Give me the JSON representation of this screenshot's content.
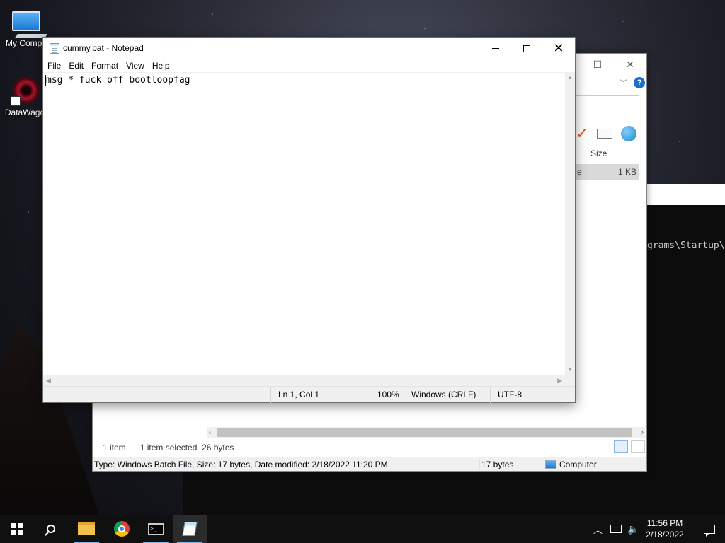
{
  "desktop": {
    "icons": [
      {
        "label": "My Compu",
        "icon": "computer-icon"
      },
      {
        "label": "DataWagor",
        "icon": "data-wagon-icon"
      }
    ]
  },
  "console": {
    "text": "grams\\Startup\\"
  },
  "explorer": {
    "column_size": "Size",
    "row_size": "1 KB",
    "row_partial": "e",
    "item_count": "1 item",
    "selection": "1 item selected  26 bytes",
    "status_details": "Type: Windows Batch File, Size: 17 bytes, Date modified: 2/18/2022 11:20 PM",
    "status_size": "17 bytes",
    "status_location": "Computer",
    "help_label": "?"
  },
  "notepad": {
    "title": "cummy.bat - Notepad",
    "menu": [
      "File",
      "Edit",
      "Format",
      "View",
      "Help"
    ],
    "content": "msg * fuck off bootloopfag",
    "status": {
      "position": "Ln 1, Col 1",
      "zoom": "100%",
      "line_ending": "Windows (CRLF)",
      "encoding": "UTF-8"
    }
  },
  "taskbar": {
    "apps": [
      "start",
      "search",
      "file-explorer",
      "chrome",
      "command-prompt",
      "notepad"
    ],
    "time": "11:56 PM",
    "date": "2/18/2022"
  },
  "colors": {
    "taskbar": "#101010",
    "accent_indicator": "#76b9ed",
    "selection_gray": "#d9d9d9"
  }
}
